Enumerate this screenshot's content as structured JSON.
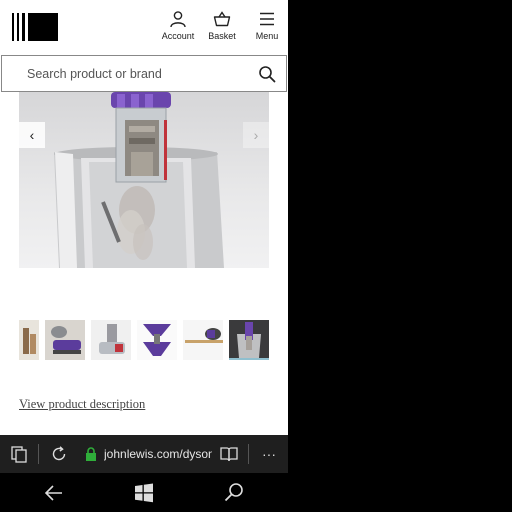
{
  "header": {
    "account_label": "Account",
    "basket_label": "Basket",
    "menu_label": "Menu",
    "logo_icon": "john-lewis-logo"
  },
  "search": {
    "placeholder": "Search product or brand",
    "icon": "search-icon"
  },
  "gallery": {
    "prev_glyph": "‹",
    "next_glyph": "›",
    "thumbnails": [
      "thumb-1",
      "thumb-2",
      "thumb-3",
      "thumb-4",
      "thumb-5",
      "thumb-6"
    ]
  },
  "product": {
    "description_link": "View product description"
  },
  "browser": {
    "url": "johnlewis.com/dyson",
    "more_glyph": "···"
  },
  "colors": {
    "accent_purple": "#5b3c9c",
    "lock_green": "#2fae3a",
    "thumb_selected": "#8fbfcf"
  }
}
